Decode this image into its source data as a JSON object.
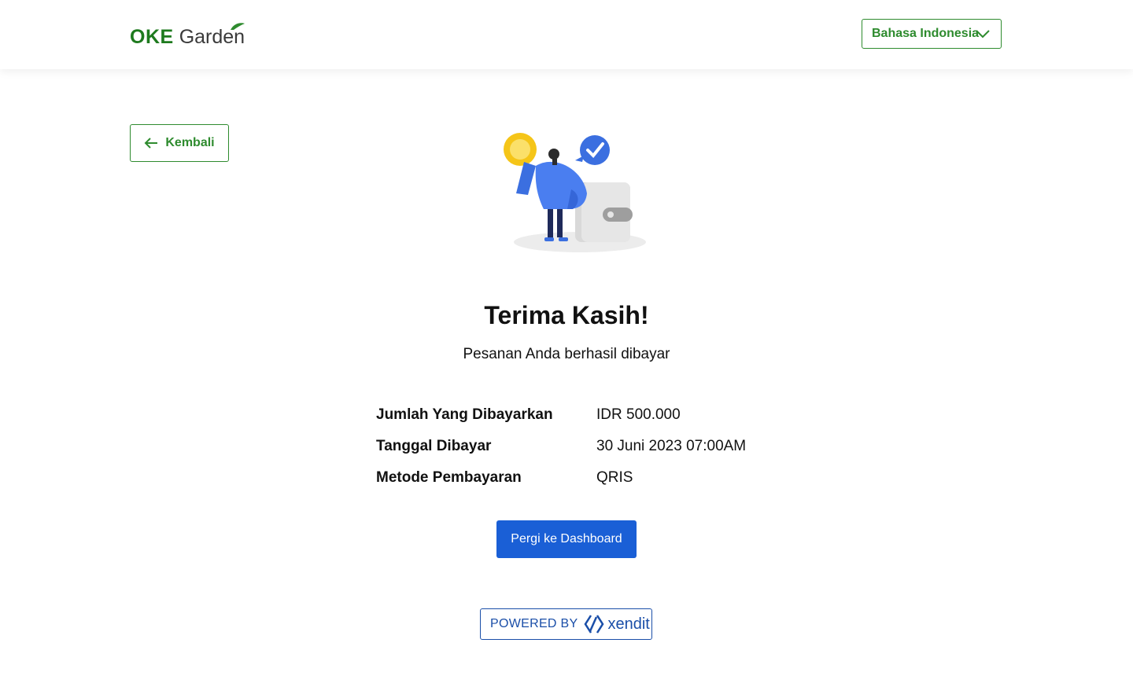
{
  "header": {
    "logo": {
      "part1": "OKE",
      "part2": "Garden"
    },
    "language_select": {
      "value": "Bahasa Indonesia",
      "icon": "chevron-down-icon"
    }
  },
  "back_button": {
    "label": "Kembali",
    "icon": "arrow-left-icon"
  },
  "illustration": {
    "name": "payment-success-illustration"
  },
  "main": {
    "title": "Terima Kasih!",
    "subtitle": "Pesanan Anda berhasil dibayar",
    "details": [
      {
        "label": "Jumlah Yang Dibayarkan",
        "value": "IDR 500.000"
      },
      {
        "label": "Tanggal Dibayar",
        "value": "30 Juni 2023 07:00AM"
      },
      {
        "label": "Metode Pembayaran",
        "value": "QRIS"
      }
    ],
    "dashboard_button": "Pergi ke Dashboard"
  },
  "footer": {
    "powered_by": "POWERED BY",
    "brand": "xendit"
  },
  "colors": {
    "brand_green": "#2e8b2e",
    "primary_blue": "#1a5fd6",
    "xendit_blue": "#1a4ea8"
  }
}
